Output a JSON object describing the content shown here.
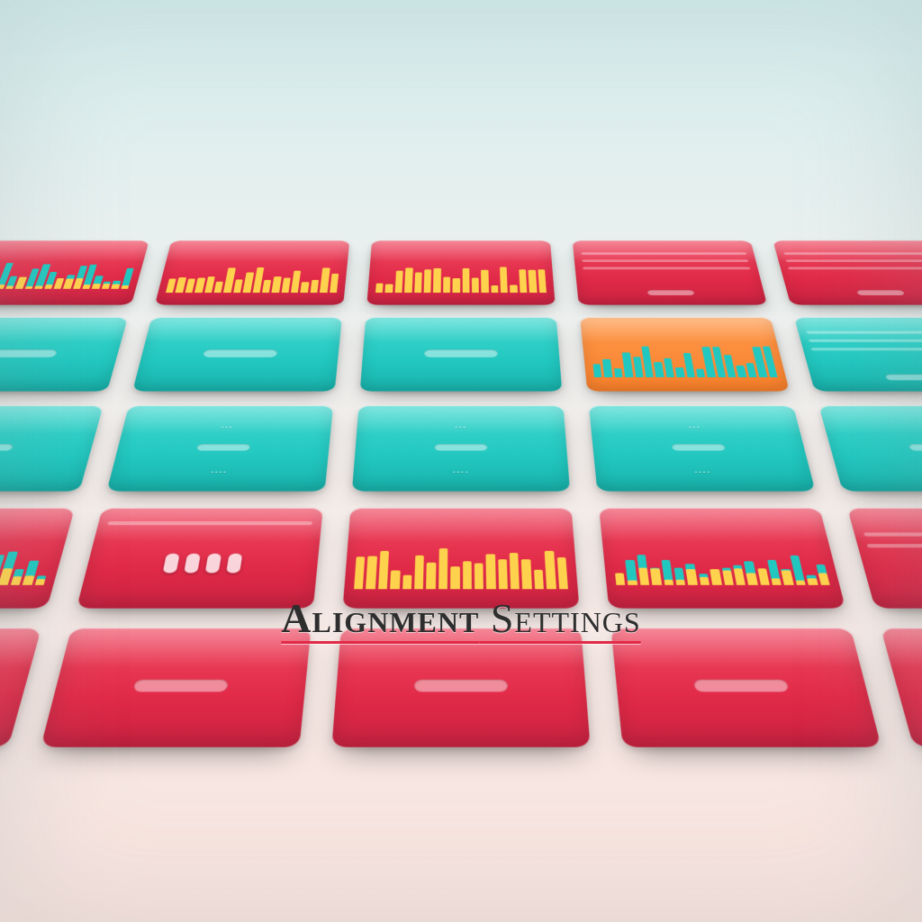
{
  "title": {
    "strong": "Alignment",
    "rest": " Settings"
  },
  "colors": {
    "red": "#e12a48",
    "teal": "#22c8c0",
    "orange": "#ff8a2a",
    "yellow": "#ffd24d"
  },
  "grid": {
    "cols": 5,
    "rows": 5,
    "cards": [
      {
        "base": "red",
        "deco": "skyline-mix",
        "label": ""
      },
      {
        "base": "red",
        "deco": "skyline-yel",
        "label": ""
      },
      {
        "base": "red",
        "deco": "skyline-yel",
        "label": ""
      },
      {
        "base": "red",
        "deco": "stripes",
        "label": ""
      },
      {
        "base": "red",
        "deco": "stripes",
        "label": ""
      },
      {
        "base": "teal",
        "deco": "slot",
        "label": ""
      },
      {
        "base": "teal",
        "deco": "slot",
        "label": ""
      },
      {
        "base": "teal",
        "deco": "slot",
        "label": ""
      },
      {
        "base": "orange",
        "deco": "skyline-teal",
        "label": ""
      },
      {
        "base": "teal",
        "deco": "stripes",
        "label": ""
      },
      {
        "base": "teal",
        "deco": "slot-double",
        "label": ""
      },
      {
        "base": "teal",
        "deco": "slot-double",
        "label": ""
      },
      {
        "base": "teal",
        "deco": "slot-double",
        "label": ""
      },
      {
        "base": "teal",
        "deco": "slot-double",
        "label": ""
      },
      {
        "base": "teal",
        "deco": "slot-double",
        "label": ""
      },
      {
        "base": "red",
        "deco": "skyline-teal-yel",
        "label": ""
      },
      {
        "base": "red",
        "deco": "pills",
        "label": ""
      },
      {
        "base": "red",
        "deco": "skyline-yel",
        "label": ""
      },
      {
        "base": "red",
        "deco": "skyline-teal-yel",
        "label": ""
      },
      {
        "base": "red",
        "deco": "badge",
        "label": ""
      },
      {
        "base": "red",
        "deco": "slot",
        "label": ""
      },
      {
        "base": "red",
        "deco": "slot",
        "label": ""
      },
      {
        "base": "red",
        "deco": "slot",
        "label": ""
      },
      {
        "base": "red",
        "deco": "slot",
        "label": ""
      },
      {
        "base": "red",
        "deco": "slot",
        "label": ""
      }
    ]
  }
}
